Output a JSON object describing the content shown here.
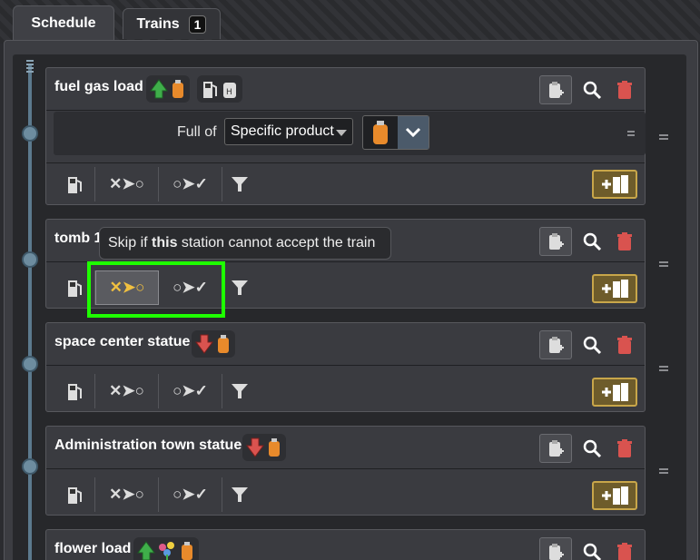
{
  "tabs": [
    {
      "label": "Schedule",
      "active": true
    },
    {
      "label": "Trains",
      "count": "1",
      "active": false
    }
  ],
  "stations": [
    {
      "name": "fuel gas load"
    },
    {
      "name": "tomb 1"
    },
    {
      "name": "space center statue"
    },
    {
      "name": "Administration town statue"
    },
    {
      "name": "flower load"
    }
  ],
  "condition": {
    "label": "Full of",
    "dropdown_value": "Specific product"
  },
  "tooltip": {
    "prefix": "Skip if ",
    "emphasis": "this",
    "suffix": " station cannot accept the train"
  },
  "controls": {
    "skip_glyph": "✕➤○",
    "wait_glyph": "○➤✓"
  },
  "colors": {
    "highlight": "#1eff00",
    "add_button_border": "#c8a64a",
    "delete_icon": "#d9534f"
  }
}
